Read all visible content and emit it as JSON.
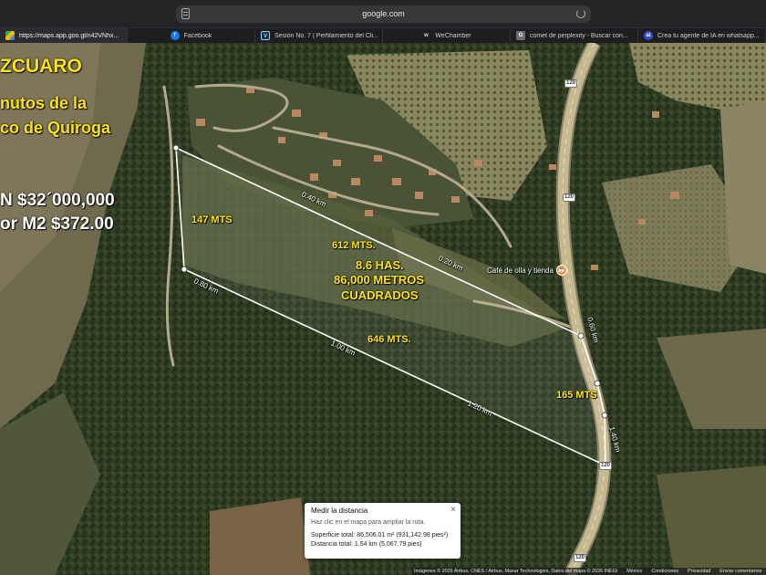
{
  "browser": {
    "url": "google.com",
    "tabs": [
      {
        "label": "https://maps.app.goo.gl/n42VNhx...",
        "icon": "google-maps-icon",
        "active": true
      },
      {
        "label": "Facebook",
        "icon": "facebook-icon"
      },
      {
        "label": "Sesión No. 7 | Perfilamiento del Cli...",
        "icon": "vimeo-icon"
      },
      {
        "label": "WeChamber",
        "icon": "wechamber-icon"
      },
      {
        "label": "comet de perplexity - Buscar con...",
        "icon": "google-icon"
      },
      {
        "label": "Crea tu agente de IA en whatsapp...",
        "icon": "ai-agent-icon"
      }
    ]
  },
  "overlay": {
    "title": "ZCUARO",
    "subtitle_line1": "nutos de la",
    "subtitle_line2": "co de Quiroga",
    "price": "N $32´000,000",
    "price_m2": "or M2 $372.00",
    "label_147": "147 MTS",
    "label_612": "612 MTS.",
    "area_line1": "8.6 HAS.",
    "area_line2": "86,000 METROS",
    "area_line3": "CUADRADOS",
    "label_646": "646 MTS.",
    "label_165": "165 MTS"
  },
  "measure_labels": {
    "d040": "0.40 km",
    "d020": "0.20 km",
    "d080": "0.80 km",
    "d100": "1.00 km",
    "d120": "1.20 km",
    "d140": "1.40 km",
    "d060": "0.60 km"
  },
  "poi": {
    "label": "Café de olla y tienda",
    "icon": "coffee-icon"
  },
  "routes": [
    "120",
    "120",
    "120",
    "120"
  ],
  "measure_panel": {
    "title": "Medir la distancia",
    "hint": "Haz clic en el mapa para ampliar la ruta.",
    "area": "Superficie total: 86,506.01 m² (931,142.98 pies²)",
    "distance": "Distancia total: 1.54 km (5,067.79 pies)",
    "close": "×"
  },
  "attribution": {
    "credits": "Imágenes © 2026 Airbus, CNES / Airbus, Maxar Technologies, Datos del mapa © 2026 INEGI",
    "country": "México",
    "terms": "Condiciones",
    "privacy": "Privacidad",
    "feedback": "Enviar comentarios"
  },
  "colors": {
    "overlay_text": "#ffe600",
    "price_text": "#ffffff",
    "measure_line": "#ffffff",
    "poi_pin": "#f28d1f",
    "road": "#c7b98f"
  }
}
